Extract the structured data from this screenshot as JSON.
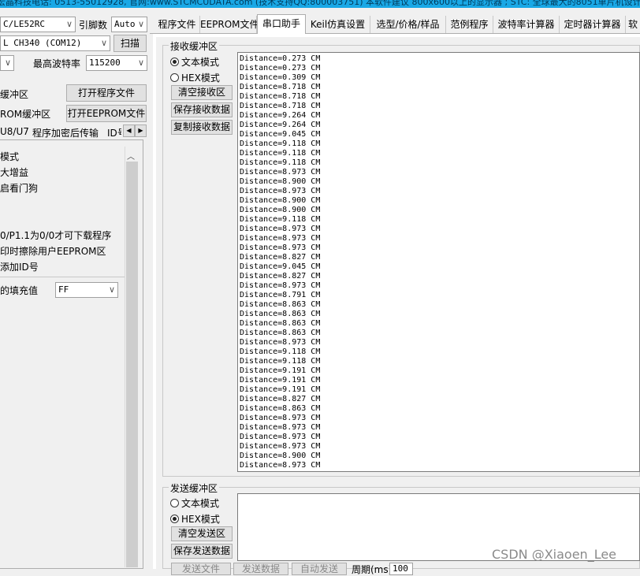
{
  "header": {
    "marquee": "宏晶科技电话: 0513-55012928, 官网:www.STCMCUDATA.com (技术支持QQ:800003751) 本软件建议 800x600以上的显示器 ; STC: 全球最大的8051单片机设计"
  },
  "left": {
    "mcu_type": "C/LE52RC",
    "pin_label": "引脚数",
    "pin_value": "Auto",
    "port_value": "L CH340 (COM12)",
    "scan_button": "扫描",
    "max_baud_label": "最高波特率",
    "max_baud_value": "115200",
    "prog_buf_label": "缓冲区",
    "open_prog_button": "打开程序文件",
    "eeprom_buf_label": "ROM缓冲区",
    "open_eeprom_button": "打开EEPROM文件",
    "subtabs": [
      "U8/U7",
      "程序加密后传输",
      "ID号"
    ],
    "options": [
      "模式",
      "大增益",
      "启看门狗",
      "",
      "",
      "0/P1.1为0/0才可下载程序",
      "印时擦除用户EEPROM区",
      "添加ID号"
    ],
    "fill_label": "的填充值",
    "fill_value": "FF"
  },
  "tabs": [
    "程序文件",
    "EEPROM文件",
    "串口助手",
    "Keil仿真设置",
    "选型/价格/样品",
    "范例程序",
    "波特率计算器",
    "定时器计算器",
    "软"
  ],
  "receive": {
    "group_title": "接收缓冲区",
    "text_mode": "文本模式",
    "hex_mode": "HEX模式",
    "clear_button": "清空接收区",
    "save_button": "保存接收数据",
    "copy_button": "复制接收数据",
    "lines": [
      "Distance=0.273 CM",
      "Distance=0.273 CM",
      "Distance=0.309 CM",
      "Distance=8.718 CM",
      "Distance=8.718 CM",
      "Distance=8.718 CM",
      "Distance=9.264 CM",
      "Distance=9.264 CM",
      "Distance=9.045 CM",
      "Distance=9.118 CM",
      "Distance=9.118 CM",
      "Distance=9.118 CM",
      "Distance=8.973 CM",
      "Distance=8.900 CM",
      "Distance=8.973 CM",
      "Distance=8.900 CM",
      "Distance=8.900 CM",
      "Distance=9.118 CM",
      "Distance=8.973 CM",
      "Distance=8.973 CM",
      "Distance=8.973 CM",
      "Distance=8.827 CM",
      "Distance=9.045 CM",
      "Distance=8.827 CM",
      "Distance=8.973 CM",
      "Distance=8.791 CM",
      "Distance=8.863 CM",
      "Distance=8.863 CM",
      "Distance=8.863 CM",
      "Distance=8.863 CM",
      "Distance=8.973 CM",
      "Distance=9.118 CM",
      "Distance=9.118 CM",
      "Distance=9.191 CM",
      "Distance=9.191 CM",
      "Distance=9.191 CM",
      "Distance=8.827 CM",
      "Distance=8.863 CM",
      "Distance=8.973 CM",
      "Distance=8.973 CM",
      "Distance=8.973 CM",
      "Distance=8.973 CM",
      "Distance=8.900 CM",
      "Distance=8.973 CM"
    ]
  },
  "send": {
    "group_title": "发送缓冲区",
    "text_mode": "文本模式",
    "hex_mode": "HEX模式",
    "clear_button": "清空发送区",
    "save_button": "保存发送数据",
    "bottom_buttons": [
      "发送文件",
      "发送数据",
      "自动发送"
    ],
    "period_label": "周期(ms)",
    "period_value": "100"
  },
  "watermark": "CSDN @Xiaoen_Lee"
}
